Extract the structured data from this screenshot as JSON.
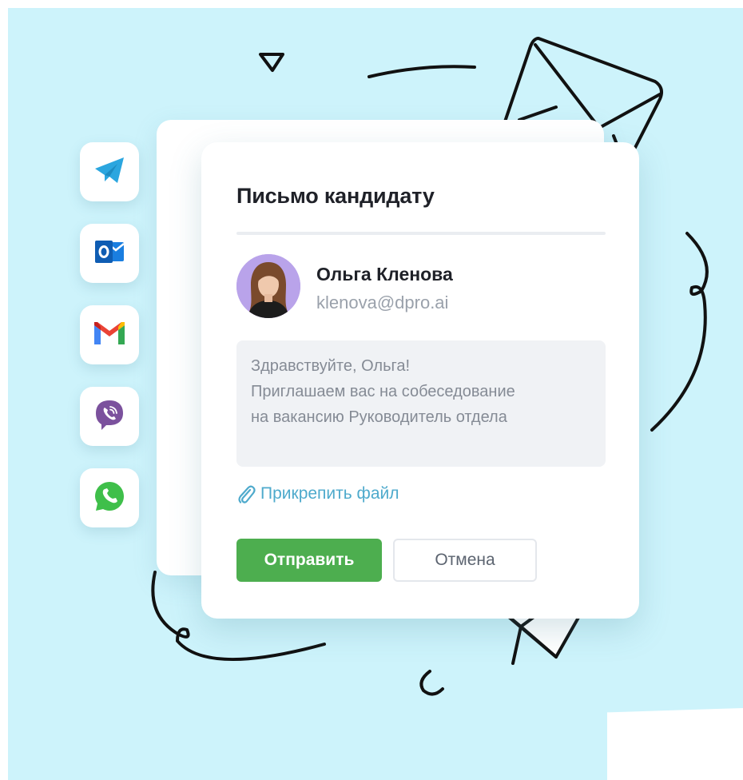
{
  "dialog": {
    "title": "Письмо кандидату",
    "candidate": {
      "name": "Ольга Кленова",
      "email": "klenova@dpro.ai"
    },
    "message_lines": [
      "Здравствуйте, Ольга!",
      "Приглашаем вас на собеседование",
      "на вакансию Руководитель отдела"
    ],
    "attach_label": "Прикрепить файл",
    "send_label": "Отправить",
    "cancel_label": "Отмена"
  },
  "messengers": [
    {
      "icon": "telegram-icon"
    },
    {
      "icon": "outlook-icon"
    },
    {
      "icon": "gmail-icon"
    },
    {
      "icon": "viber-icon"
    },
    {
      "icon": "whatsapp-icon"
    }
  ],
  "colors": {
    "background": "#cdf3fb",
    "send_button": "#4dae4f",
    "link": "#4eaacc",
    "telegram": "#2ba6df",
    "outlook": "#1066c4",
    "viber": "#7b519d",
    "whatsapp": "#3fbf4a"
  }
}
